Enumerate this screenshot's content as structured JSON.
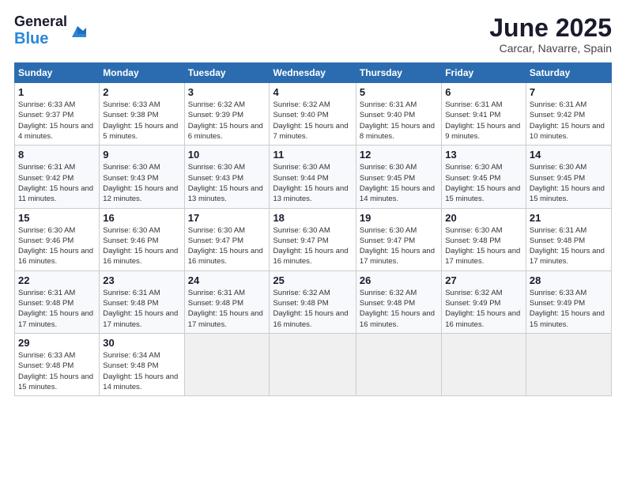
{
  "logo": {
    "general": "General",
    "blue": "Blue"
  },
  "title": "June 2025",
  "location": "Carcar, Navarre, Spain",
  "headers": [
    "Sunday",
    "Monday",
    "Tuesday",
    "Wednesday",
    "Thursday",
    "Friday",
    "Saturday"
  ],
  "weeks": [
    [
      {
        "day": "1",
        "sunrise": "Sunrise: 6:33 AM",
        "sunset": "Sunset: 9:37 PM",
        "daylight": "Daylight: 15 hours and 4 minutes."
      },
      {
        "day": "2",
        "sunrise": "Sunrise: 6:33 AM",
        "sunset": "Sunset: 9:38 PM",
        "daylight": "Daylight: 15 hours and 5 minutes."
      },
      {
        "day": "3",
        "sunrise": "Sunrise: 6:32 AM",
        "sunset": "Sunset: 9:39 PM",
        "daylight": "Daylight: 15 hours and 6 minutes."
      },
      {
        "day": "4",
        "sunrise": "Sunrise: 6:32 AM",
        "sunset": "Sunset: 9:40 PM",
        "daylight": "Daylight: 15 hours and 7 minutes."
      },
      {
        "day": "5",
        "sunrise": "Sunrise: 6:31 AM",
        "sunset": "Sunset: 9:40 PM",
        "daylight": "Daylight: 15 hours and 8 minutes."
      },
      {
        "day": "6",
        "sunrise": "Sunrise: 6:31 AM",
        "sunset": "Sunset: 9:41 PM",
        "daylight": "Daylight: 15 hours and 9 minutes."
      },
      {
        "day": "7",
        "sunrise": "Sunrise: 6:31 AM",
        "sunset": "Sunset: 9:42 PM",
        "daylight": "Daylight: 15 hours and 10 minutes."
      }
    ],
    [
      {
        "day": "8",
        "sunrise": "Sunrise: 6:31 AM",
        "sunset": "Sunset: 9:42 PM",
        "daylight": "Daylight: 15 hours and 11 minutes."
      },
      {
        "day": "9",
        "sunrise": "Sunrise: 6:30 AM",
        "sunset": "Sunset: 9:43 PM",
        "daylight": "Daylight: 15 hours and 12 minutes."
      },
      {
        "day": "10",
        "sunrise": "Sunrise: 6:30 AM",
        "sunset": "Sunset: 9:43 PM",
        "daylight": "Daylight: 15 hours and 13 minutes."
      },
      {
        "day": "11",
        "sunrise": "Sunrise: 6:30 AM",
        "sunset": "Sunset: 9:44 PM",
        "daylight": "Daylight: 15 hours and 13 minutes."
      },
      {
        "day": "12",
        "sunrise": "Sunrise: 6:30 AM",
        "sunset": "Sunset: 9:45 PM",
        "daylight": "Daylight: 15 hours and 14 minutes."
      },
      {
        "day": "13",
        "sunrise": "Sunrise: 6:30 AM",
        "sunset": "Sunset: 9:45 PM",
        "daylight": "Daylight: 15 hours and 15 minutes."
      },
      {
        "day": "14",
        "sunrise": "Sunrise: 6:30 AM",
        "sunset": "Sunset: 9:45 PM",
        "daylight": "Daylight: 15 hours and 15 minutes."
      }
    ],
    [
      {
        "day": "15",
        "sunrise": "Sunrise: 6:30 AM",
        "sunset": "Sunset: 9:46 PM",
        "daylight": "Daylight: 15 hours and 16 minutes."
      },
      {
        "day": "16",
        "sunrise": "Sunrise: 6:30 AM",
        "sunset": "Sunset: 9:46 PM",
        "daylight": "Daylight: 15 hours and 16 minutes."
      },
      {
        "day": "17",
        "sunrise": "Sunrise: 6:30 AM",
        "sunset": "Sunset: 9:47 PM",
        "daylight": "Daylight: 15 hours and 16 minutes."
      },
      {
        "day": "18",
        "sunrise": "Sunrise: 6:30 AM",
        "sunset": "Sunset: 9:47 PM",
        "daylight": "Daylight: 15 hours and 16 minutes."
      },
      {
        "day": "19",
        "sunrise": "Sunrise: 6:30 AM",
        "sunset": "Sunset: 9:47 PM",
        "daylight": "Daylight: 15 hours and 17 minutes."
      },
      {
        "day": "20",
        "sunrise": "Sunrise: 6:30 AM",
        "sunset": "Sunset: 9:48 PM",
        "daylight": "Daylight: 15 hours and 17 minutes."
      },
      {
        "day": "21",
        "sunrise": "Sunrise: 6:31 AM",
        "sunset": "Sunset: 9:48 PM",
        "daylight": "Daylight: 15 hours and 17 minutes."
      }
    ],
    [
      {
        "day": "22",
        "sunrise": "Sunrise: 6:31 AM",
        "sunset": "Sunset: 9:48 PM",
        "daylight": "Daylight: 15 hours and 17 minutes."
      },
      {
        "day": "23",
        "sunrise": "Sunrise: 6:31 AM",
        "sunset": "Sunset: 9:48 PM",
        "daylight": "Daylight: 15 hours and 17 minutes."
      },
      {
        "day": "24",
        "sunrise": "Sunrise: 6:31 AM",
        "sunset": "Sunset: 9:48 PM",
        "daylight": "Daylight: 15 hours and 17 minutes."
      },
      {
        "day": "25",
        "sunrise": "Sunrise: 6:32 AM",
        "sunset": "Sunset: 9:48 PM",
        "daylight": "Daylight: 15 hours and 16 minutes."
      },
      {
        "day": "26",
        "sunrise": "Sunrise: 6:32 AM",
        "sunset": "Sunset: 9:48 PM",
        "daylight": "Daylight: 15 hours and 16 minutes."
      },
      {
        "day": "27",
        "sunrise": "Sunrise: 6:32 AM",
        "sunset": "Sunset: 9:49 PM",
        "daylight": "Daylight: 15 hours and 16 minutes."
      },
      {
        "day": "28",
        "sunrise": "Sunrise: 6:33 AM",
        "sunset": "Sunset: 9:49 PM",
        "daylight": "Daylight: 15 hours and 15 minutes."
      }
    ],
    [
      {
        "day": "29",
        "sunrise": "Sunrise: 6:33 AM",
        "sunset": "Sunset: 9:48 PM",
        "daylight": "Daylight: 15 hours and 15 minutes."
      },
      {
        "day": "30",
        "sunrise": "Sunrise: 6:34 AM",
        "sunset": "Sunset: 9:48 PM",
        "daylight": "Daylight: 15 hours and 14 minutes."
      },
      null,
      null,
      null,
      null,
      null
    ]
  ]
}
